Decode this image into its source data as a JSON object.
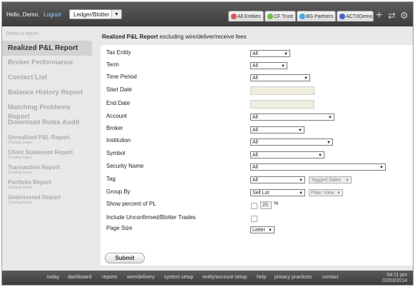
{
  "header": {
    "greeting": "Hello, Demo.",
    "logout": "Logout",
    "view_select": "Ledger/Blotter",
    "entities": [
      {
        "label": "All Entities",
        "color": "#e05555"
      },
      {
        "label": "CF Trust",
        "color": "#6cc04a"
      },
      {
        "label": "BG Partners",
        "color": "#4aa8e0"
      },
      {
        "label": "ACTXDemo",
        "color": "#4a5fd0"
      }
    ],
    "icons": [
      "add-icon",
      "refresh-icon",
      "gear-icon"
    ]
  },
  "sidebar": {
    "heading": "Select a report",
    "items": [
      {
        "label": "Realized P&L Report",
        "active": true
      },
      {
        "label": "Broker Performance"
      },
      {
        "label": "Contact List"
      },
      {
        "label": "Balance History Report"
      },
      {
        "label": "Matching Problems Report"
      },
      {
        "label": "Download Rules Audit"
      }
    ],
    "coming": [
      {
        "label": "Unrealized P&L Report",
        "sub": "(Coming Soon)"
      },
      {
        "label": "Client Statement Report",
        "sub": "(Coming Soon)"
      },
      {
        "label": "Transaction Report",
        "sub": "(Coming Soon)"
      },
      {
        "label": "Portfolio Report",
        "sub": "(Coming Soon)"
      },
      {
        "label": "Undelivered Report",
        "sub": "(Coming Soon)"
      }
    ]
  },
  "main": {
    "title_bold": "Realized P&L Report",
    "title_rest": "excluding wire/deliver/receive fees",
    "fields": {
      "tax_entity": {
        "label": "Tax Entity",
        "value": "All"
      },
      "term": {
        "label": "Term",
        "value": "All"
      },
      "time_period": {
        "label": "Time Period",
        "value": "All"
      },
      "start_date": {
        "label": "Start Date",
        "value": ""
      },
      "end_date": {
        "label": "End Date",
        "value": ""
      },
      "account": {
        "label": "Account",
        "value": "All"
      },
      "broker": {
        "label": "Broker",
        "value": "All"
      },
      "institution": {
        "label": "Institution",
        "value": "All"
      },
      "symbol": {
        "label": "Symbol",
        "value": "All"
      },
      "security_name": {
        "label": "Security Name",
        "value": "All"
      },
      "tag": {
        "label": "Tag",
        "value": "All",
        "secondary": "Tagged Sales"
      },
      "group_by": {
        "label": "Group By",
        "value": "Sell Lot",
        "secondary": "Plain View"
      },
      "show_percent": {
        "label": "Show percent of PL",
        "checked": false,
        "percent": "25",
        "unit": "%"
      },
      "include_unconfirmed": {
        "label": "Include Unconfirmed/Blotter Trades",
        "checked": false
      },
      "page_size": {
        "label": "Page Size",
        "value": "Letter"
      }
    },
    "submit": "Submit"
  },
  "footer": {
    "links": [
      "today",
      "dashboard",
      "reports",
      "wire/delivery",
      "system setup",
      "entity/account setup",
      "help",
      "privacy practices",
      "contact"
    ],
    "time": "04:11 pm",
    "date": "02/03/2014"
  }
}
